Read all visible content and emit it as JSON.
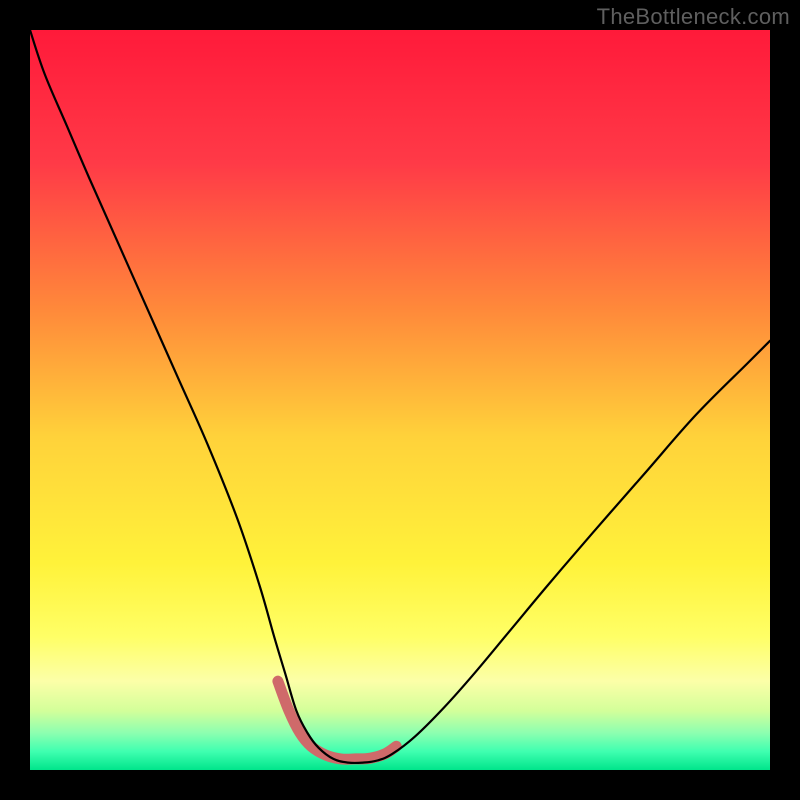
{
  "watermark": "TheBottleneck.com",
  "chart_data": {
    "type": "line",
    "title": "",
    "xlabel": "",
    "ylabel": "",
    "xlim": [
      0,
      100
    ],
    "ylim": [
      0,
      100
    ],
    "gradient_stops": [
      {
        "offset": 0.0,
        "color": "#ff1a3a"
      },
      {
        "offset": 0.18,
        "color": "#ff3a47"
      },
      {
        "offset": 0.38,
        "color": "#ff8a3a"
      },
      {
        "offset": 0.55,
        "color": "#ffd23a"
      },
      {
        "offset": 0.72,
        "color": "#fff23a"
      },
      {
        "offset": 0.82,
        "color": "#ffff66"
      },
      {
        "offset": 0.88,
        "color": "#fcffa8"
      },
      {
        "offset": 0.92,
        "color": "#d3ff9a"
      },
      {
        "offset": 0.95,
        "color": "#8cffb0"
      },
      {
        "offset": 0.975,
        "color": "#3fffb0"
      },
      {
        "offset": 1.0,
        "color": "#00e58b"
      }
    ],
    "series": [
      {
        "name": "bottleneck-curve",
        "color": "#000000",
        "width": 2.2,
        "x": [
          0,
          2,
          5,
          8,
          12,
          16,
          20,
          24,
          28,
          31,
          33,
          34.5,
          36,
          37.5,
          39,
          41,
          43,
          45,
          47,
          49,
          52,
          56,
          60,
          65,
          70,
          76,
          83,
          90,
          97,
          100
        ],
        "y": [
          100,
          94,
          87,
          80,
          71,
          62,
          53,
          44,
          34,
          25,
          18,
          13,
          8,
          5,
          3,
          1.5,
          1,
          1,
          1.3,
          2.2,
          4.5,
          8.5,
          13,
          19,
          25,
          32,
          40,
          48,
          55,
          58
        ]
      },
      {
        "name": "highlight-band",
        "color": "#cf6a6a",
        "width": 11,
        "x": [
          33.5,
          35,
          36.5,
          38,
          40,
          42,
          44,
          46,
          48,
          49.5
        ],
        "y": [
          12,
          8,
          5,
          3.2,
          2,
          1.5,
          1.5,
          1.6,
          2.2,
          3.2
        ]
      }
    ],
    "annotations": []
  }
}
